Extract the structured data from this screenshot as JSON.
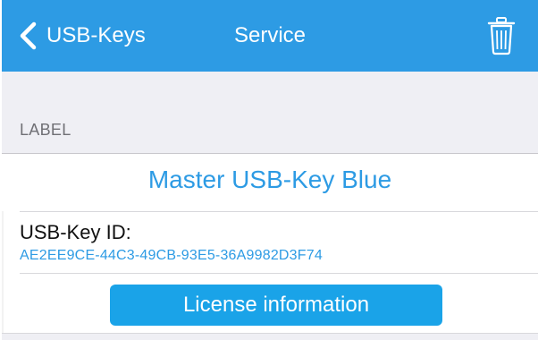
{
  "nav": {
    "back_label": "USB-Keys",
    "title": "Service",
    "back_icon": "chevron-left-icon",
    "delete_icon": "trash-icon"
  },
  "section": {
    "header": "LABEL",
    "label_value": "Master USB-Key Blue",
    "id_label": "USB-Key ID:",
    "id_value": "AE2EE9CE-44C3-49CB-93E5-36A9982D3F74",
    "license_button": "License information"
  },
  "colors": {
    "accent": "#2d9be4",
    "nav_background": "#2d9be4",
    "button_background": "#1aa3e8",
    "grouped_background": "#efeff4"
  }
}
